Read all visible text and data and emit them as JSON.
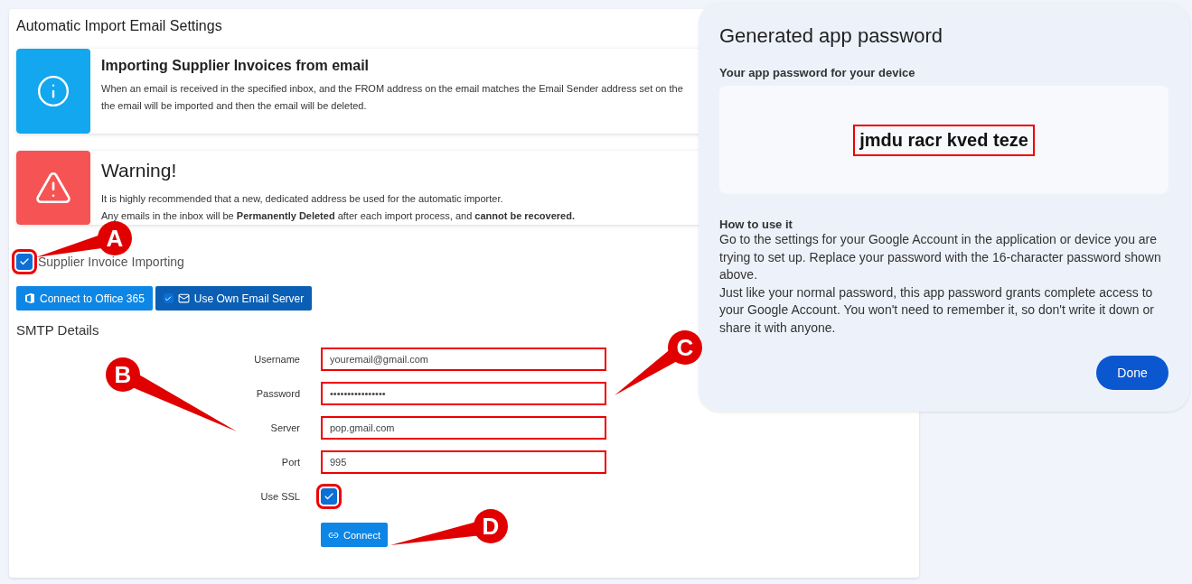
{
  "settings": {
    "title": "Automatic Import Email Settings",
    "notices": [
      {
        "kind": "info",
        "heading": "Importing Supplier Invoices from email",
        "lines": [
          "When an email is received in the specified inbox, and the FROM address on the email matches the Email Sender address set on the",
          "the email will be imported and then the email will be deleted."
        ]
      },
      {
        "kind": "warning",
        "heading": "Warning!",
        "lines": [
          "It is highly recommended that a new, dedicated address be used for the automatic importer.",
          "Any emails in the inbox will be **Permanently Deleted** after each import process, and **cannot be recovered.**"
        ]
      }
    ],
    "enable": {
      "label": "Supplier Invoice Importing",
      "checked": true,
      "highlighted": true
    },
    "buttons": [
      {
        "label": "Connect to Office 365",
        "kind": "office",
        "selected": false
      },
      {
        "label": "Use Own Email Server",
        "kind": "server",
        "selected": true
      }
    ],
    "section": "SMTP Details",
    "fields": [
      {
        "kind": "text",
        "label": "Username",
        "value": "youremail@gmail.com",
        "highlighted": true
      },
      {
        "kind": "text",
        "label": "Password",
        "value": "••••••••••••••••",
        "highlighted": true
      },
      {
        "kind": "text",
        "label": "Server",
        "value": "pop.gmail.com",
        "highlighted": true
      },
      {
        "kind": "text",
        "label": "Port",
        "value": "995",
        "highlighted": true
      },
      {
        "kind": "checkbox",
        "label": "Use SSL",
        "checked": true,
        "highlighted": true
      }
    ],
    "connect": {
      "label": "Connect"
    }
  },
  "dialog": {
    "title": "Generated app password",
    "subtitle": "Your app password for your device",
    "password": "jmdu racr kved teze",
    "password_highlighted": true,
    "how_heading": "How to use it",
    "paragraphs": [
      "Go to the settings for your Google Account in the application or device you are trying to set up. Replace your password with the 16-character password shown above.",
      "Just like your normal password, this app password grants complete access to your Google Account. You won't need to remember it, so don't write it down or share it with anyone."
    ],
    "done": "Done"
  },
  "callouts": [
    {
      "label": "A"
    },
    {
      "label": "B"
    },
    {
      "label": "C"
    },
    {
      "label": "D"
    }
  ]
}
